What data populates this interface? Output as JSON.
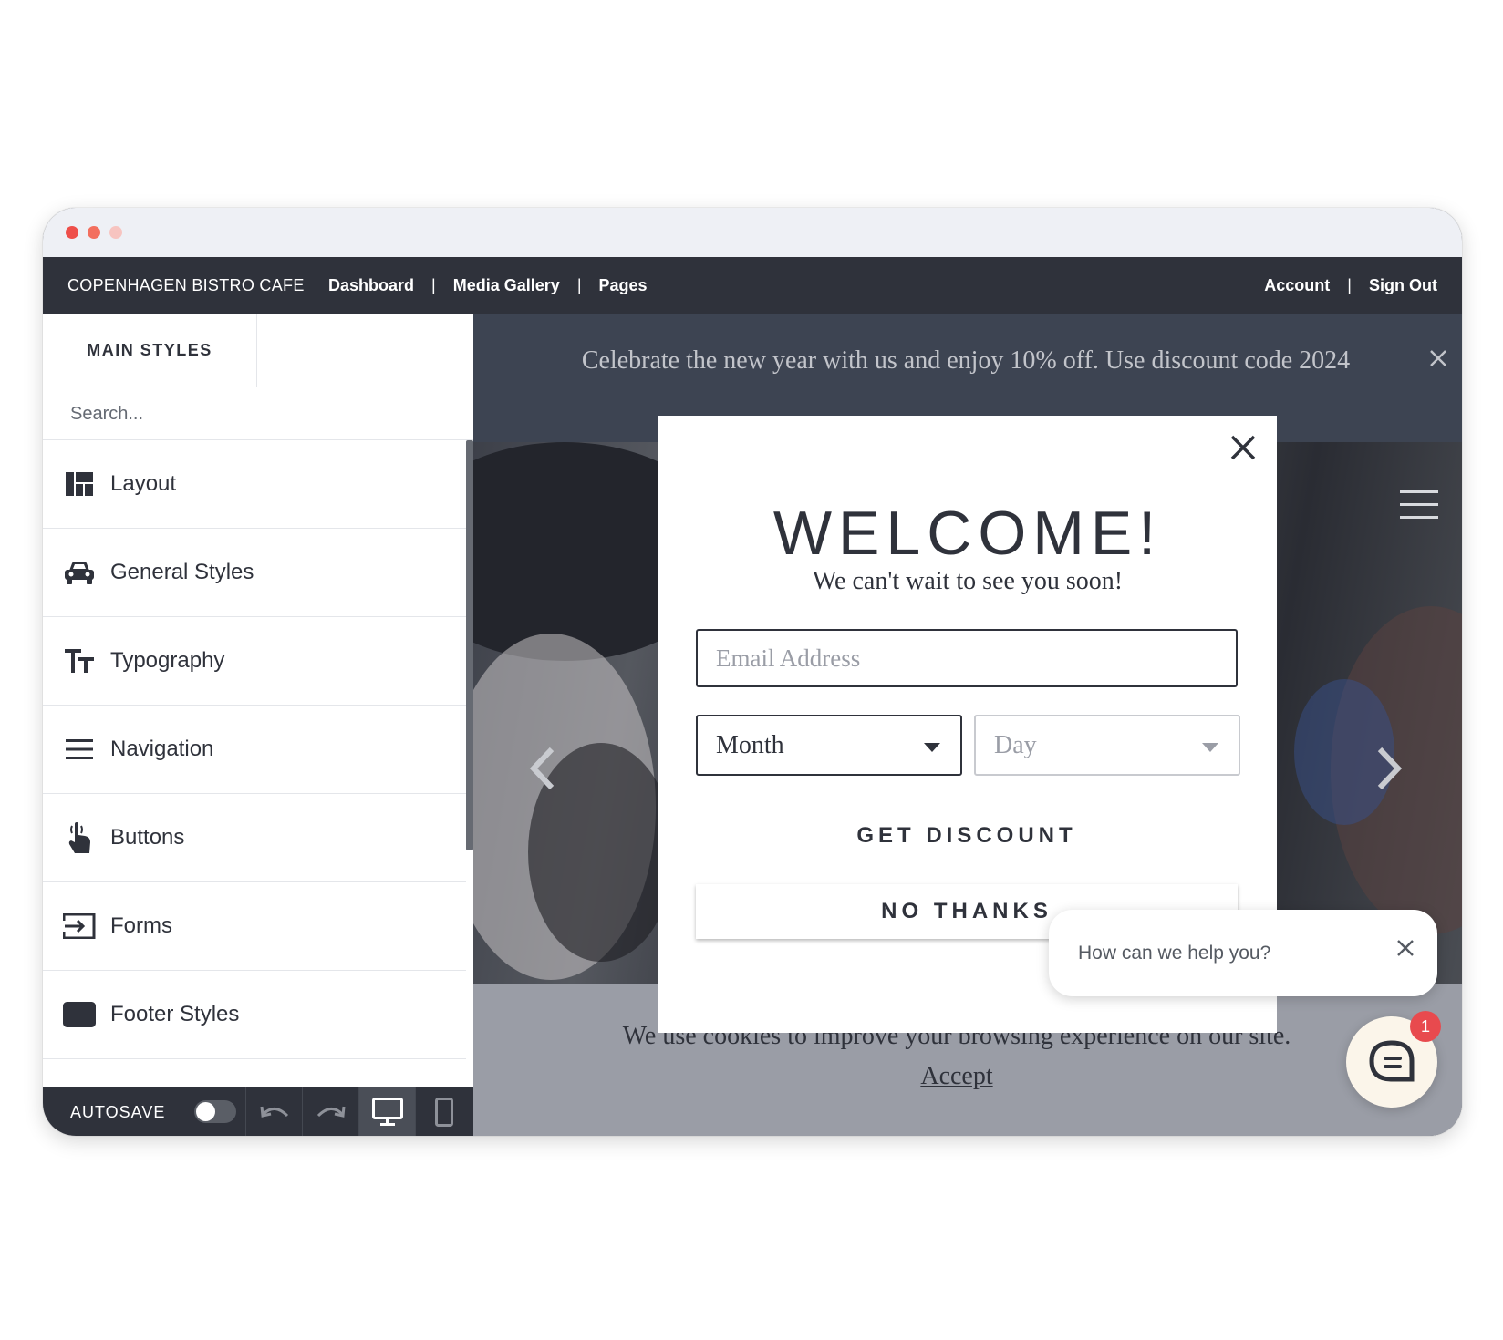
{
  "colors": {
    "nav_bg": "#2f323b",
    "traffic_red": "#ee4f4a",
    "traffic_orange": "#f36f5e",
    "traffic_pink": "#f7c4c0",
    "announcement_bg": "#3d4452",
    "cookie_bg": "#9a9da6",
    "chat_badge": "#e84a4e"
  },
  "topnav": {
    "brand": "COPENHAGEN BISTRO CAFE",
    "links": [
      {
        "label": "Dashboard"
      },
      {
        "label": "Media Gallery"
      },
      {
        "label": "Pages"
      }
    ],
    "separator": "|",
    "account": "Account",
    "sign_out": "Sign Out"
  },
  "sidebar": {
    "tab_label": "MAIN STYLES",
    "search_placeholder": "Search...",
    "items": [
      {
        "label": "Layout",
        "icon": "layout-icon"
      },
      {
        "label": "General Styles",
        "icon": "car-icon"
      },
      {
        "label": "Typography",
        "icon": "text-size-icon"
      },
      {
        "label": "Navigation",
        "icon": "hamburger-icon"
      },
      {
        "label": "Buttons",
        "icon": "pointer-hand-icon"
      },
      {
        "label": "Forms",
        "icon": "sign-in-icon"
      },
      {
        "label": "Footer Styles",
        "icon": "footer-icon"
      }
    ],
    "bottombar": {
      "autosave_label": "AUTOSAVE",
      "autosave_on": false,
      "active_device": "desktop"
    }
  },
  "preview": {
    "announcement": "Celebrate the new year with us and enjoy 10% off. Use discount code 2024",
    "cookie_text": "We use cookies to improve your browsing experience on our site.",
    "cookie_accept": "Accept"
  },
  "modal": {
    "title": "WELCOME!",
    "subtitle": "We can't wait to see you soon!",
    "email_placeholder": "Email Address",
    "month_label": "Month",
    "day_label": "Day",
    "get_discount": "GET DISCOUNT",
    "no_thanks": "NO THANKS"
  },
  "chat": {
    "prompt": "How can we help you?",
    "badge_count": "1"
  }
}
